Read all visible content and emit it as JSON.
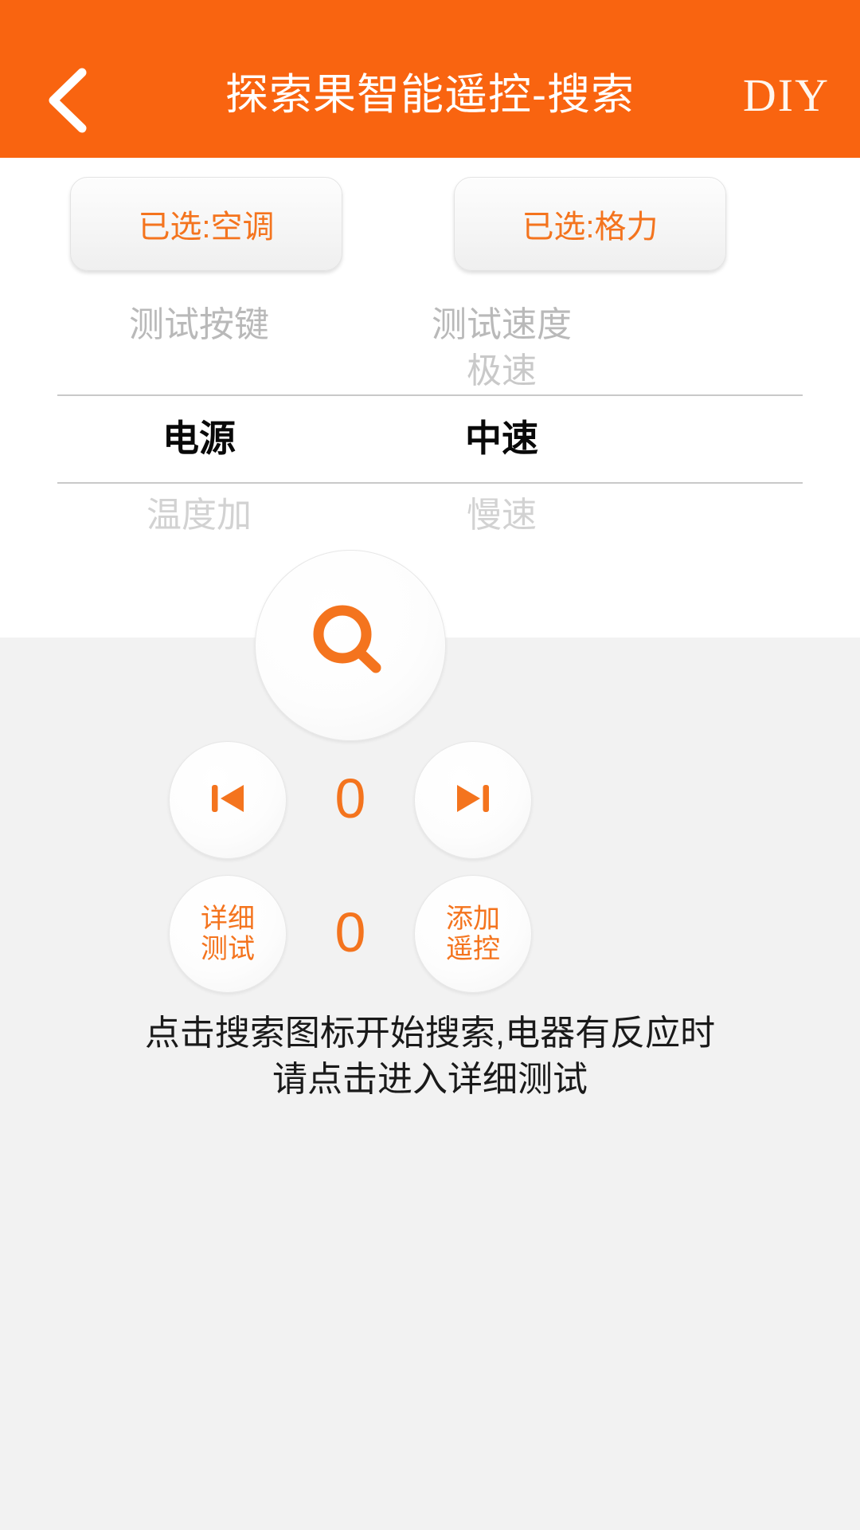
{
  "header": {
    "back_icon": "chevron-left-icon",
    "title": "探索果智能遥控-搜索",
    "diy_label": "DIY",
    "bar_color": "#F96410",
    "title_color": "#FFFFFF"
  },
  "selectors": [
    {
      "label": "已选:空调",
      "name": "device-type-selector"
    },
    {
      "label": "已选:格力",
      "name": "device-brand-selector"
    }
  ],
  "pickers": {
    "accent_color": "#F4741E",
    "key_picker": {
      "header": "测试按键",
      "above2": "测试按键",
      "above1": "",
      "selected": "电源",
      "below1": "温度加"
    },
    "speed_picker": {
      "header": "测试速度",
      "above2": "测试速度",
      "above1": "极速",
      "selected": "中速",
      "below1": "慢速"
    }
  },
  "pad": {
    "background": "#F2F2F2",
    "search_icon": "search-icon",
    "prev_icon": "skip-previous-icon",
    "next_icon": "skip-next-icon",
    "counter_top": "0",
    "counter_bottom": "0",
    "detail_test_label": "详细\n测试",
    "add_remote_label": "添加\n遥控",
    "hint_line1": "点击搜索图标开始搜索,电器有反应时",
    "hint_line2": "请点击进入详细测试"
  }
}
